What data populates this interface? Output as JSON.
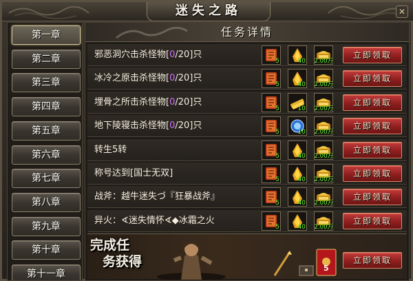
{
  "window": {
    "title": "迷失之路",
    "close_icon": "close-icon"
  },
  "chapters": [
    "第一章",
    "第二章",
    "第三章",
    "第四章",
    "第五章",
    "第六章",
    "第七章",
    "第八章",
    "第九章",
    "第十章",
    "第十一章"
  ],
  "active_chapter": 0,
  "panel": {
    "title": "任务详情"
  },
  "tasks": [
    {
      "name": "邪恶洞穴击杀怪物",
      "progress": "0",
      "total": "/20]只",
      "rewards": [
        "5",
        "40",
        "2.00万"
      ],
      "items": [
        "scroll",
        "ingot",
        "gold"
      ]
    },
    {
      "name": "冰冷之原击杀怪物",
      "progress": "0",
      "total": "/20]只",
      "rewards": [
        "5",
        "40",
        "2.00万"
      ],
      "items": [
        "scroll",
        "ingot",
        "gold"
      ]
    },
    {
      "name": "埋骨之所击杀怪物",
      "progress": "0",
      "total": "/20]只",
      "rewards": [
        "5",
        "10",
        "2.00万"
      ],
      "items": [
        "scroll",
        "bars",
        "gold"
      ]
    },
    {
      "name": "地下陵寝击杀怪物",
      "progress": "0",
      "total": "/20]只",
      "rewards": [
        "5",
        "10",
        "2.00万"
      ],
      "items": [
        "scroll",
        "gem",
        "gold"
      ]
    },
    {
      "name": "转生5转",
      "rewards": [
        "5",
        "40",
        "2.00万"
      ],
      "items": [
        "scroll",
        "ingot",
        "gold"
      ]
    },
    {
      "name": "称号达到[国士无双]",
      "rewards": [
        "5",
        "40",
        "2.00万"
      ],
      "items": [
        "scroll",
        "ingot",
        "gold"
      ]
    },
    {
      "name": "战斧：越牛迷失づ『狂暴战斧』",
      "rewards": [
        "5",
        "40",
        "2.00万"
      ],
      "items": [
        "scroll",
        "ingot",
        "gold"
      ]
    },
    {
      "name": "异火：∢迷失情怀∢◆冰霜之火",
      "rewards": [
        "5",
        "40",
        "2.00万"
      ],
      "items": [
        "scroll",
        "ingot",
        "gold"
      ]
    }
  ],
  "claim_label": "立即领取",
  "bottom": {
    "text_line1": "完成任",
    "text_line2": "务获得",
    "chest_count": "5",
    "claim_label": "立即领取"
  },
  "colors": {
    "progress": "#d070ff",
    "count": "#66ff33",
    "claim_red": "#a02a2a"
  }
}
